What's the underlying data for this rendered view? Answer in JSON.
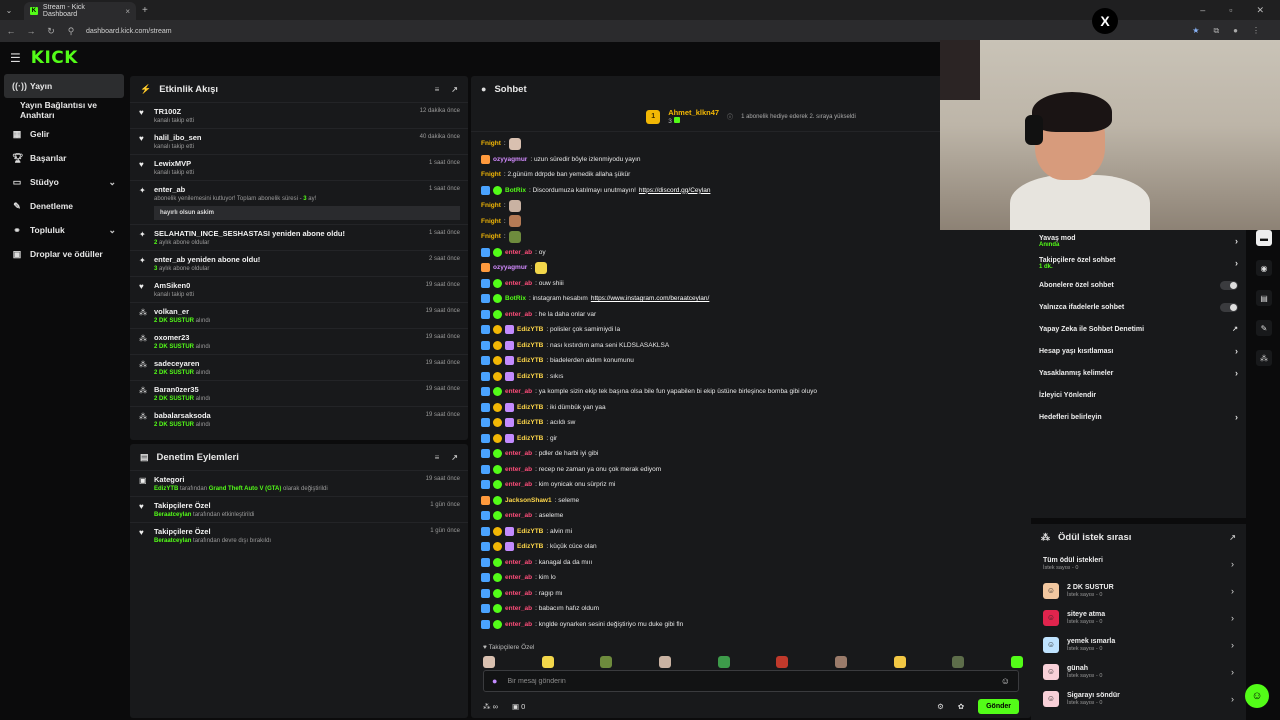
{
  "browser": {
    "tab_title": "Stream - Kick Dashboard",
    "url": "dashboard.kick.com/stream"
  },
  "header": {
    "logo": "KICK"
  },
  "nav": {
    "items": [
      {
        "label": "Yayın",
        "icon": "broadcast-icon"
      },
      {
        "label": "Yayın Bağlantısı ve Anahtarı",
        "icon": ""
      },
      {
        "label": "Gelir",
        "icon": "revenue-icon"
      },
      {
        "label": "Başarılar",
        "icon": "trophy-icon"
      },
      {
        "label": "Stüdyo",
        "icon": "studio-icon"
      },
      {
        "label": "Denetleme",
        "icon": "wrench-icon"
      },
      {
        "label": "Topluluk",
        "icon": "community-icon"
      },
      {
        "label": "Droplar ve ödüller",
        "icon": "gift-icon"
      }
    ]
  },
  "activity": {
    "title": "Etkinlik Akışı",
    "events": [
      {
        "name": "TR100Z",
        "sub": "kanalı takip etti",
        "time": "12 dakika önce"
      },
      {
        "name": "halil_ibo_sen",
        "sub": "kanalı takip etti",
        "time": "40 dakika önce"
      },
      {
        "name": "LewixMVP",
        "sub": "kanalı takip etti",
        "time": "1 saat önce"
      },
      {
        "name": "enter_ab",
        "sub_a": "abonelik yenilemesini kutluyor! Toplam abonelik süresi - ",
        "sub_b": "3",
        "sub_c": " ay!",
        "message": "hayırlı olsun askim",
        "time": "1 saat önce"
      },
      {
        "name": "SELAHATIN_INCE_SESHASTASI yeniden abone oldu!",
        "sub_a": "2",
        "sub_c": " aylık abone oldular",
        "time": "1 saat önce"
      },
      {
        "name": "enter_ab yeniden abone oldu!",
        "sub_a": "3",
        "sub_c": " aylık abone oldular",
        "time": "2 saat önce"
      },
      {
        "name": "AmSiken0",
        "sub": "kanalı takip etti",
        "time": "19 saat önce"
      },
      {
        "name": "volkan_er",
        "sub_a": "2 DK SUSTUR",
        "sub_c": " alındı",
        "time": "19 saat önce"
      },
      {
        "name": "oxomer23",
        "sub_a": "2 DK SUSTUR",
        "sub_c": " alındı",
        "time": "19 saat önce"
      },
      {
        "name": "sadeceyaren",
        "sub_a": "2 DK SUSTUR",
        "sub_c": " alındı",
        "time": "19 saat önce"
      },
      {
        "name": "Baran0zer35",
        "sub_a": "2 DK SUSTUR",
        "sub_c": " alındı",
        "time": "19 saat önce"
      },
      {
        "name": "babalarsaksoda",
        "sub_a": "2 DK SUSTUR",
        "sub_c": " alındı",
        "time": "19 saat önce"
      }
    ]
  },
  "modlog": {
    "title": "Denetim Eylemleri",
    "items": [
      {
        "name": "Kategori",
        "user": "EdizYTB",
        "mid": " tarafından ",
        "target": "Grand Theft Auto V (GTA)",
        "end": " olarak değiştirildi",
        "time": "19 saat önce"
      },
      {
        "name": "Takipçilere Özel",
        "user": "Beraatceylan",
        "mid": " tarafından etkinleştirildi",
        "time": "1 gün önce"
      },
      {
        "name": "Takipçilere Özel",
        "user": "Beraatceylan",
        "mid": " tarafından devre dışı bırakıldı",
        "time": "1 gün önce"
      }
    ]
  },
  "chat": {
    "title": "Sohbet",
    "pinned": {
      "name": "Ahmet_klkn47",
      "count": "3",
      "note": "1 abonelik hediye ederek 2. sıraya yükseldi"
    },
    "messages": [
      {
        "user": "Fnight",
        "text": "",
        "color": "u-gold",
        "badges": [],
        "emote": "#d9c0b0"
      },
      {
        "user": "ozyyagmur",
        "text": ": uzun süredir böyle izlenmiyodu yayın",
        "color": "u-lav",
        "badges": [
          "b-orange"
        ]
      },
      {
        "user": "Fnight",
        "text": ": 2.günüm ddrpde ban yemedik allaha şükür",
        "color": "u-gold",
        "badges": []
      },
      {
        "user": "BotRix",
        "text": ": Discordumuza katılmayı unutmayın! ",
        "link": "https://discord.gg/Ceylan",
        "color": "u-green",
        "badges": [
          "b-blue",
          "b-green"
        ]
      },
      {
        "user": "Fnight",
        "text": "",
        "color": "u-gold",
        "badges": [],
        "emote": "#c9b2a2"
      },
      {
        "user": "Fnight",
        "text": "",
        "color": "u-gold",
        "badges": [],
        "emote": "#b47a55"
      },
      {
        "user": "Fnight",
        "text": "",
        "color": "u-gold",
        "badges": [],
        "emote": "#6e8b3d"
      },
      {
        "user": "enter_ab",
        "text": ": oy",
        "color": "u-pink",
        "badges": [
          "b-blue",
          "b-green"
        ]
      },
      {
        "user": "ozyyagmur",
        "text": "",
        "color": "u-lav",
        "badges": [
          "b-orange"
        ],
        "emote": "#f2d64a"
      },
      {
        "user": "enter_ab",
        "text": ": ouw shiii",
        "color": "u-pink",
        "badges": [
          "b-blue",
          "b-green"
        ]
      },
      {
        "user": "BotRix",
        "text": ": instagram hesabım ",
        "link": "https://www.instagram.com/beraatceylan/",
        "color": "u-green",
        "badges": [
          "b-blue",
          "b-green"
        ]
      },
      {
        "user": "enter_ab",
        "text": ": he la daha onlar var",
        "color": "u-pink",
        "badges": [
          "b-blue",
          "b-green"
        ]
      },
      {
        "user": "EdizYTB",
        "text": ": polisler çok samimiydi la",
        "color": "u-yel",
        "badges": [
          "b-blue",
          "b-gold",
          "b-purple"
        ]
      },
      {
        "user": "EdizYTB",
        "text": ": nası kıstırdım ama seni KLDSLASAKLSA",
        "color": "u-yel",
        "badges": [
          "b-blue",
          "b-gold",
          "b-purple"
        ]
      },
      {
        "user": "EdizYTB",
        "text": ": biadelerden aldım konumunu",
        "color": "u-yel",
        "badges": [
          "b-blue",
          "b-gold",
          "b-purple"
        ]
      },
      {
        "user": "EdizYTB",
        "text": ": sıkıs",
        "color": "u-yel",
        "badges": [
          "b-blue",
          "b-gold",
          "b-purple"
        ]
      },
      {
        "user": "enter_ab",
        "text": ": ya komple sizin ekip tek başına olsa bile fun yapabilen bi ekip üstüne birleşince bomba gibi oluyo",
        "color": "u-pink",
        "badges": [
          "b-blue",
          "b-green"
        ]
      },
      {
        "user": "EdizYTB",
        "text": ": iki dümbük yan yaa",
        "color": "u-yel",
        "badges": [
          "b-blue",
          "b-gold",
          "b-purple"
        ]
      },
      {
        "user": "EdizYTB",
        "text": ": acıldı sw",
        "color": "u-yel",
        "badges": [
          "b-blue",
          "b-gold",
          "b-purple"
        ]
      },
      {
        "user": "EdizYTB",
        "text": ": gir",
        "color": "u-yel",
        "badges": [
          "b-blue",
          "b-gold",
          "b-purple"
        ]
      },
      {
        "user": "enter_ab",
        "text": ": pdler de harbi iyi gibi",
        "color": "u-pink",
        "badges": [
          "b-blue",
          "b-green"
        ]
      },
      {
        "user": "enter_ab",
        "text": ": recep ne zaman ya onu çok merak ediyom",
        "color": "u-pink",
        "badges": [
          "b-blue",
          "b-green"
        ]
      },
      {
        "user": "enter_ab",
        "text": ": kim oynicak onu sürpriz mi",
        "color": "u-pink",
        "badges": [
          "b-blue",
          "b-green"
        ]
      },
      {
        "user": "JacksonShaw1",
        "text": ": seleme",
        "color": "u-yel",
        "badges": [
          "b-orange",
          "b-green"
        ]
      },
      {
        "user": "enter_ab",
        "text": ": aselеme",
        "color": "u-pink",
        "badges": [
          "b-blue",
          "b-green"
        ]
      },
      {
        "user": "EdizYTB",
        "text": ": alvin mi",
        "color": "u-yel",
        "badges": [
          "b-blue",
          "b-gold",
          "b-purple"
        ]
      },
      {
        "user": "EdizYTB",
        "text": ": küçük cüce olan",
        "color": "u-yel",
        "badges": [
          "b-blue",
          "b-gold",
          "b-purple"
        ]
      },
      {
        "user": "enter_ab",
        "text": ": kanagal da da mııı",
        "color": "u-pink",
        "badges": [
          "b-blue",
          "b-green"
        ]
      },
      {
        "user": "enter_ab",
        "text": ": kim lo",
        "color": "u-pink",
        "badges": [
          "b-blue",
          "b-green"
        ]
      },
      {
        "user": "enter_ab",
        "text": ": ragıp mı",
        "color": "u-pink",
        "badges": [
          "b-blue",
          "b-green"
        ]
      },
      {
        "user": "enter_ab",
        "text": ": babacım hafız oldum",
        "color": "u-pink",
        "badges": [
          "b-blue",
          "b-green"
        ]
      },
      {
        "user": "enter_ab",
        "text": ": knglde oynarken sesini değiştiriyo mu duke gibi fln",
        "color": "u-pink",
        "badges": [
          "b-blue",
          "b-green"
        ]
      }
    ],
    "followers_only_label": "Takipçilere Özel",
    "emotes": [
      "#d9c0b0",
      "#f2d64a",
      "#6e8b3d",
      "#c9b2a2",
      "#3d9b4a",
      "#c0392b",
      "#9a7b6a",
      "#f2c744",
      "#5d6d4a",
      "#53fc18"
    ],
    "input_placeholder": "Bir mesaj gönderin",
    "points": "∞",
    "gift_count": "0",
    "send_label": "Gönder"
  },
  "settings": {
    "rows": [
      {
        "label": "Yavaş mod",
        "value": "Anında",
        "type": "chevron"
      },
      {
        "label": "Takipçilere özel sohbet",
        "value": "1 dk.",
        "type": "chevron"
      },
      {
        "label": "Abonelere özel sohbet",
        "value": "",
        "type": "toggle"
      },
      {
        "label": "Yalnızca ifadelerle sohbet",
        "value": "",
        "type": "toggle"
      },
      {
        "label": "Yapay Zeka ile Sohbet Denetimi",
        "value": "",
        "type": "external"
      },
      {
        "label": "Hesap yaşı kısıtlaması",
        "value": "",
        "type": "chevron"
      },
      {
        "label": "Yasaklanmış kelimeler",
        "value": "",
        "type": "chevron"
      },
      {
        "label": "İzleyici Yönlendir",
        "value": "",
        "type": "none"
      },
      {
        "label": "Hedefleri belirleyin",
        "value": "",
        "type": "chevron"
      }
    ]
  },
  "rewards": {
    "title": "Ödül istek sırası",
    "all": {
      "name": "Tüm ödül istekleri",
      "sub": "İstek sayısı - 0"
    },
    "items": [
      {
        "name": "2 DK SUSTUR",
        "sub": "İstek sayısı - 0",
        "color": "#f2c7a0"
      },
      {
        "name": "siteye atma",
        "sub": "İstek sayısı - 0",
        "color": "#e0244d"
      },
      {
        "name": "yemek ısmarla",
        "sub": "İstek sayısı - 0",
        "color": "#bfe3ff"
      },
      {
        "name": "günah",
        "sub": "İstek sayısı - 0",
        "color": "#f8d0d8"
      },
      {
        "name": "Sigarayı söndür",
        "sub": "İstek sayısı - 0",
        "color": "#f8d0d8"
      }
    ]
  }
}
